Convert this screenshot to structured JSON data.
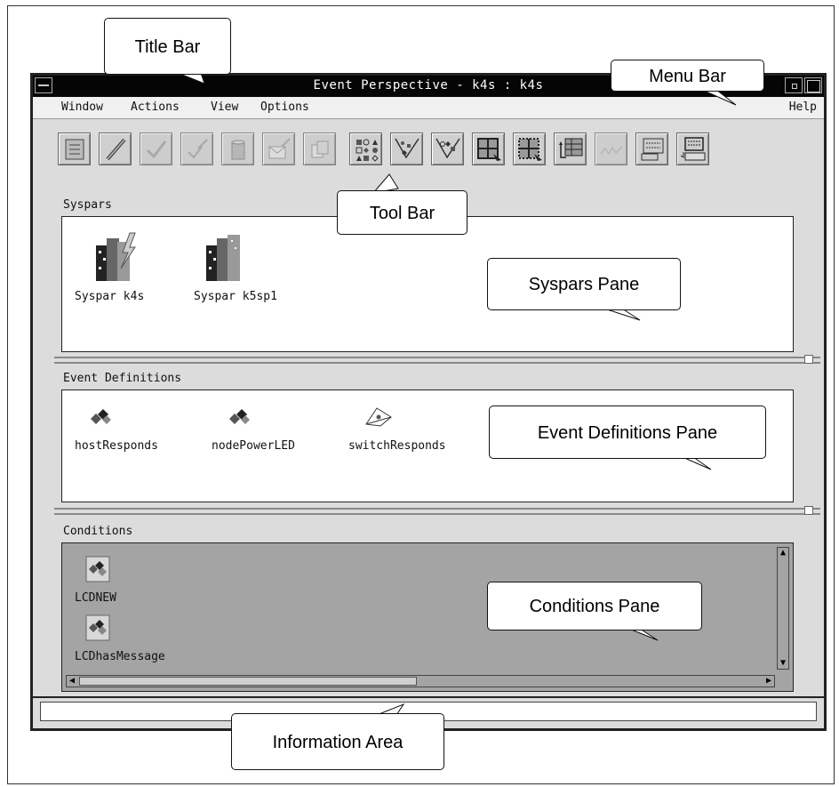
{
  "window": {
    "title": "Event Perspective - k4s : k4s"
  },
  "menubar": {
    "items": [
      "Window",
      "Actions",
      "View",
      "Options"
    ],
    "help": "Help"
  },
  "toolbar": {
    "buttons": [
      {
        "icon": "notebook-icon",
        "enabled": true
      },
      {
        "icon": "pencil-icon",
        "enabled": true
      },
      {
        "icon": "check-icon",
        "enabled": false
      },
      {
        "icon": "check-pencil-icon",
        "enabled": false
      },
      {
        "icon": "trash-can-icon",
        "enabled": false
      },
      {
        "icon": "envelope-pencil-icon",
        "enabled": false
      },
      {
        "icon": "duplicate-icon",
        "enabled": false
      },
      {
        "icon": "shapes-grid-icon",
        "enabled": true
      },
      {
        "icon": "filter-funnel-icon",
        "enabled": true
      },
      {
        "icon": "funnel-shapes-icon",
        "enabled": true
      },
      {
        "icon": "grid-select-icon",
        "enabled": true
      },
      {
        "icon": "grid-dotted-select-icon",
        "enabled": true
      },
      {
        "icon": "table-sort-icon",
        "enabled": true
      },
      {
        "icon": "signature-icon",
        "enabled": false
      },
      {
        "icon": "list-view-icon",
        "enabled": true
      },
      {
        "icon": "terminal-icon",
        "enabled": true
      }
    ]
  },
  "panes": {
    "syspars": {
      "label": "Syspars",
      "items": [
        "Syspar k4s",
        "Syspar k5sp1"
      ]
    },
    "event_definitions": {
      "label": "Event Definitions",
      "items": [
        "hostResponds",
        "nodePowerLED",
        "switchResponds"
      ]
    },
    "conditions": {
      "label": "Conditions",
      "items": [
        "LCDNEW",
        "LCDhasMessage"
      ]
    }
  },
  "callouts": {
    "title_bar": "Title Bar",
    "menu_bar": "Menu Bar",
    "tool_bar": "Tool Bar",
    "syspars_pane": "Syspars Pane",
    "event_definitions_pane": "Event Definitions Pane",
    "conditions_pane": "Conditions Pane",
    "information_area": "Information Area"
  }
}
